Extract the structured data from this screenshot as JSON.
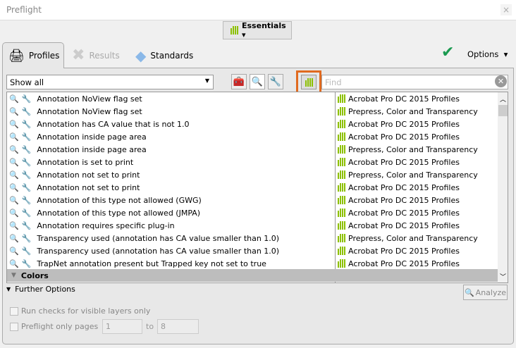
{
  "window": {
    "title": "Preflight",
    "close": "×"
  },
  "toolbar": {
    "essentials": "Essentials ▾"
  },
  "tabs": [
    {
      "label": "Profiles"
    },
    {
      "label": "Results"
    },
    {
      "label": "Standards"
    }
  ],
  "options": "Options",
  "filter": {
    "value": "Show all"
  },
  "find": {
    "placeholder": "Find"
  },
  "rows": [
    {
      "name": "Annotation NoView flag set",
      "profile": "Acrobat Pro DC 2015 Profiles"
    },
    {
      "name": "Annotation NoView flag set",
      "profile": "Prepress, Color and Transparency"
    },
    {
      "name": "Annotation has CA value that is not 1.0",
      "profile": "Acrobat Pro DC 2015 Profiles"
    },
    {
      "name": "Annotation inside page area",
      "profile": "Acrobat Pro DC 2015 Profiles"
    },
    {
      "name": "Annotation inside page area",
      "profile": "Prepress, Color and Transparency"
    },
    {
      "name": "Annotation is set to print",
      "profile": "Acrobat Pro DC 2015 Profiles"
    },
    {
      "name": "Annotation not set to print",
      "profile": "Prepress, Color and Transparency"
    },
    {
      "name": "Annotation not set to print",
      "profile": "Acrobat Pro DC 2015 Profiles"
    },
    {
      "name": "Annotation of this type not allowed (GWG)",
      "profile": "Acrobat Pro DC 2015 Profiles"
    },
    {
      "name": "Annotation of this type not allowed (JMPA)",
      "profile": "Acrobat Pro DC 2015 Profiles"
    },
    {
      "name": "Annotation requires specific plug-in",
      "profile": "Acrobat Pro DC 2015 Profiles"
    },
    {
      "name": "Transparency used (annotation has CA value smaller than 1.0)",
      "profile": "Prepress, Color and Transparency"
    },
    {
      "name": "Transparency used (annotation has CA value smaller than 1.0)",
      "profile": "Acrobat Pro DC 2015 Profiles"
    },
    {
      "name": "TrapNet annotation present but Trapped key not set to true",
      "profile": "Acrobat Pro DC 2015 Profiles"
    }
  ],
  "group": "Colors",
  "further": "Further Options",
  "analyze": "Analyze",
  "visible_layers": "Run checks for visible layers only",
  "pages": {
    "label": "Preflight only pages",
    "from": "1",
    "to_label": "to",
    "to": "8"
  }
}
